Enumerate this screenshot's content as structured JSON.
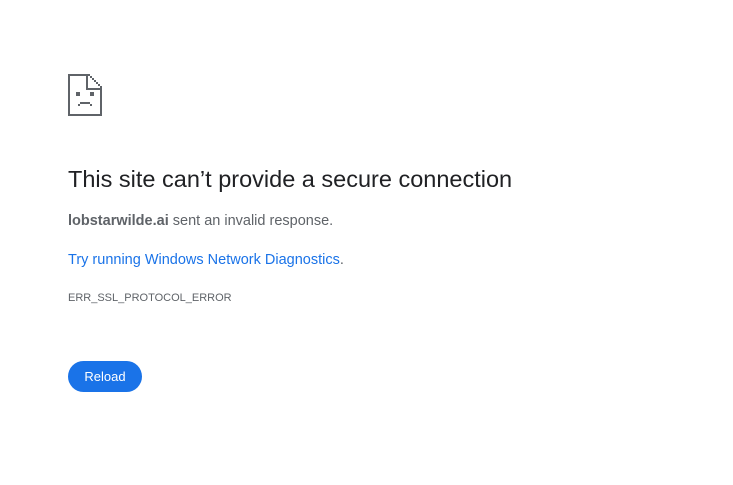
{
  "error_page": {
    "icon": "sad-document-icon",
    "title": "This site can’t provide a secure connection",
    "message": {
      "host": "lobstarwilde.ai",
      "text": " sent an invalid response."
    },
    "suggestion": {
      "link_text": "Try running Windows Network Diagnostics",
      "trailing": "."
    },
    "error_code": "ERR_SSL_PROTOCOL_ERROR",
    "reload_label": "Reload"
  },
  "colors": {
    "accent": "#1a73e8",
    "title_text": "#202124",
    "body_text": "#5f6368",
    "background": "#ffffff"
  }
}
